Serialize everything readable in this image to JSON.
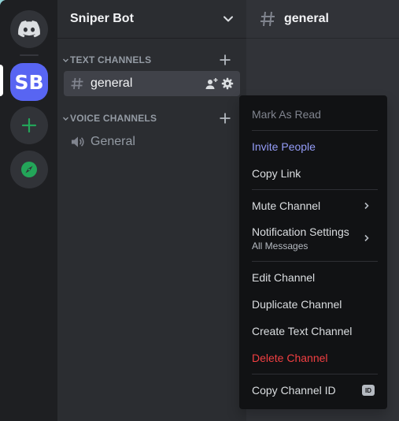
{
  "colors": {
    "rail_bg": "#1e1f22",
    "sidebar_bg": "#2b2d31",
    "main_bg": "#313338",
    "menu_bg": "#111214",
    "brand": "#5865f2",
    "danger": "#f23f42",
    "green": "#23a559"
  },
  "servers": {
    "home_icon": "discord-logo-icon",
    "active_initials": "SB",
    "add_icon": "plus-icon",
    "explore_icon": "compass-icon"
  },
  "guild": {
    "name": "Sniper Bot",
    "dropdown_icon": "chevron-down-icon"
  },
  "categories": {
    "text": "TEXT CHANNELS",
    "voice": "VOICE CHANNELS"
  },
  "channels": {
    "text_general": "general",
    "voice_general": "General"
  },
  "header": {
    "channel_name": "general"
  },
  "context_menu": {
    "mark_as_read": "Mark As Read",
    "invite_people": "Invite People",
    "copy_link": "Copy Link",
    "mute_channel": "Mute Channel",
    "notification_settings": "Notification Settings",
    "notification_value": "All Messages",
    "edit_channel": "Edit Channel",
    "duplicate_channel": "Duplicate Channel",
    "create_text_channel": "Create Text Channel",
    "delete_channel": "Delete Channel",
    "copy_channel_id": "Copy Channel ID",
    "id_badge": "ID"
  }
}
